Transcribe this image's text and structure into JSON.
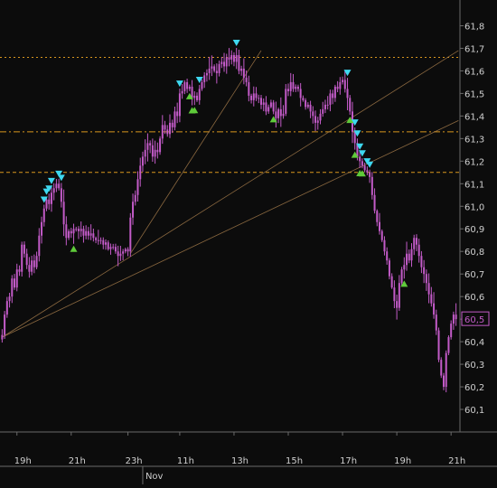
{
  "colors": {
    "background": "#0c0c0c",
    "candle": "#c35bc8",
    "hline": "#d8961e",
    "trendline": "#a37a4a",
    "grid": "#262626",
    "axis": "#6a6a6a",
    "tick_text": "#cfcfcf",
    "sell_marker": "#3ed8f0",
    "buy_marker": "#5fcb3a",
    "price_tag_border": "#c35bc8"
  },
  "icons": {
    "sell_marker": "down-triangle-icon",
    "buy_marker": "up-triangle-icon"
  },
  "chart_data": {
    "type": "candlestick",
    "title": "",
    "ylim": [
      60.0,
      61.85
    ],
    "y_ticks": [
      "61,8",
      "61,7",
      "61,6",
      "61,5",
      "61,4",
      "61,3",
      "61,2",
      "61,1",
      "61,0",
      "60,9",
      "60,8",
      "60,7",
      "60,6",
      "60,5",
      "60,4",
      "60,3",
      "60,2",
      "60,1"
    ],
    "y_tick_values": [
      61.8,
      61.7,
      61.6,
      61.5,
      61.4,
      61.3,
      61.2,
      61.1,
      61.0,
      60.9,
      60.8,
      60.7,
      60.6,
      60.5,
      60.4,
      60.3,
      60.2,
      60.1
    ],
    "x_ticks": [
      "19h",
      "21h",
      "23h",
      "11h",
      "13h",
      "15h",
      "17h",
      "19h",
      "21h"
    ],
    "x_tick_index": [
      6,
      28,
      51,
      72,
      94,
      116,
      138,
      160,
      182
    ],
    "day_label": "Nov",
    "day_label_index": 57,
    "last_price_label": "60,5",
    "last_price": 60.5,
    "horizontal_levels": [
      61.66,
      61.33,
      61.15
    ],
    "horizontal_level_styles": [
      "dotted",
      "dashdot",
      "dashed"
    ],
    "trendlines": [
      {
        "from": [
          0,
          60.42
        ],
        "to": [
          185,
          61.69
        ]
      },
      {
        "from": [
          0,
          60.42
        ],
        "to": [
          185,
          61.38
        ]
      },
      {
        "from": [
          52,
          60.79
        ],
        "to": [
          105,
          61.69
        ]
      }
    ],
    "close": [
      60.43,
      60.52,
      60.58,
      60.6,
      60.68,
      60.64,
      60.72,
      60.71,
      60.83,
      60.79,
      60.74,
      60.71,
      60.76,
      60.73,
      60.78,
      60.87,
      60.93,
      60.99,
      61.03,
      61.01,
      61.06,
      61.08,
      61.1,
      61.08,
      61.02,
      60.92,
      60.86,
      60.89,
      60.88,
      60.9,
      60.9,
      60.89,
      60.9,
      60.87,
      60.89,
      60.87,
      60.88,
      60.86,
      60.85,
      60.85,
      60.85,
      60.83,
      60.84,
      60.81,
      60.82,
      60.82,
      60.8,
      60.78,
      60.79,
      60.8,
      60.81,
      60.8,
      60.95,
      61.02,
      61.05,
      61.12,
      61.18,
      61.22,
      61.25,
      61.28,
      61.27,
      61.22,
      61.25,
      61.24,
      61.3,
      61.36,
      61.34,
      61.32,
      61.37,
      61.35,
      61.42,
      61.4,
      61.5,
      61.51,
      61.55,
      61.52,
      61.53,
      61.48,
      61.49,
      61.47,
      61.52,
      61.55,
      61.58,
      61.59,
      61.61,
      61.62,
      61.6,
      61.59,
      61.63,
      61.64,
      61.62,
      61.66,
      61.65,
      61.67,
      61.64,
      61.67,
      61.6,
      61.61,
      61.57,
      61.55,
      61.49,
      61.47,
      61.5,
      61.48,
      61.48,
      61.45,
      61.46,
      61.42,
      61.44,
      61.46,
      61.42,
      61.39,
      61.43,
      61.4,
      61.41,
      61.52,
      61.51,
      61.55,
      61.52,
      61.53,
      61.52,
      61.48,
      61.47,
      61.44,
      61.45,
      61.42,
      61.4,
      61.37,
      61.38,
      61.41,
      61.43,
      61.45,
      61.45,
      61.5,
      61.48,
      61.53,
      61.52,
      61.55,
      61.56,
      61.52,
      61.48,
      61.42,
      61.33,
      61.28,
      61.22,
      61.2,
      61.18,
      61.16,
      61.15,
      61.13,
      61.05,
      60.98,
      60.93,
      60.89,
      60.85,
      60.8,
      60.76,
      60.69,
      60.64,
      60.58,
      60.55,
      60.66,
      60.72,
      60.74,
      60.79,
      60.76,
      60.81,
      60.86,
      60.83,
      60.78,
      60.73,
      60.7,
      60.66,
      60.61,
      60.57,
      60.52,
      60.45,
      60.32,
      60.25,
      60.2,
      60.35,
      60.42,
      60.48,
      60.52,
      60.5
    ]
  }
}
